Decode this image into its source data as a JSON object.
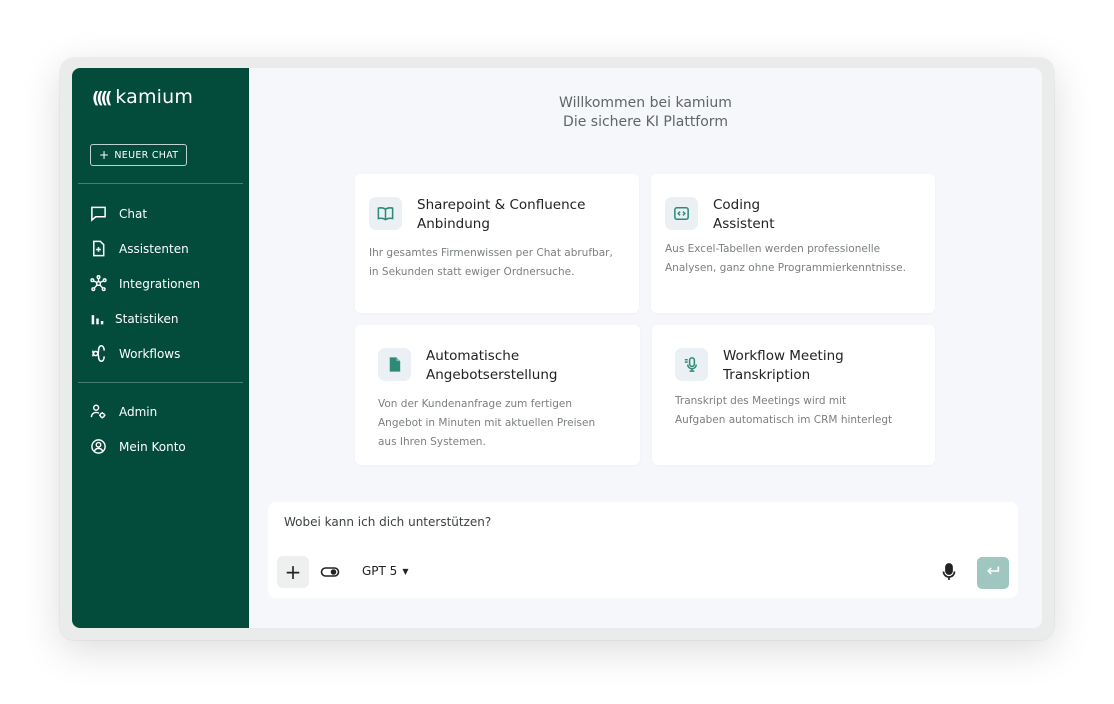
{
  "sidebar": {
    "logo_text": "kamium",
    "new_chat_label": "NEUER CHAT",
    "nav_main": [
      {
        "label": "Chat",
        "icon": "chat-icon"
      },
      {
        "label": "Assistenten",
        "icon": "assistant-icon"
      },
      {
        "label": "Integrationen",
        "icon": "integrations-icon"
      },
      {
        "label": "Statistiken",
        "icon": "statistics-icon"
      },
      {
        "label": "Workflows",
        "icon": "workflows-icon"
      }
    ],
    "nav_account": [
      {
        "label": "Admin",
        "icon": "admin-icon"
      },
      {
        "label": "Mein Konto",
        "icon": "account-icon"
      }
    ]
  },
  "header": {
    "line1": "Willkommen bei kamium",
    "line2": "Die sichere KI Plattform"
  },
  "cards": [
    {
      "title_1": "Sharepoint & Confluence",
      "title_2": "Anbindung",
      "desc_1": "Ihr gesamtes Firmenwissen per Chat abrufbar,",
      "desc_2": "in Sekunden statt ewiger Ordnersuche.",
      "desc_3": "",
      "icon": "book-icon"
    },
    {
      "title_1": "Coding",
      "title_2": "Assistent",
      "desc_1": "Aus Excel-Tabellen werden professionelle",
      "desc_2": "Analysen, ganz ohne Programmierkenntnisse.",
      "desc_3": "",
      "icon": "code-icon"
    },
    {
      "title_1": "Automatische",
      "title_2": "Angebotserstellung",
      "desc_1": "Von der Kundenanfrage zum fertigen",
      "desc_2": "Angebot in Minuten mit aktuellen Preisen",
      "desc_3": "aus Ihren Systemen.",
      "icon": "document-icon"
    },
    {
      "title_1": "Workflow Meeting",
      "title_2": "Transkription",
      "desc_1": "Transkript des Meetings wird mit",
      "desc_2": "Aufgaben automatisch im CRM hinterlegt",
      "desc_3": "",
      "icon": "microphone-icon"
    }
  ],
  "chat_input": {
    "placeholder": "Wobei kann ich dich unterstützen?",
    "value": "",
    "add_label": "+",
    "model": "GPT 5"
  },
  "colors": {
    "sidebar": "#034c3c",
    "accent_icon": "#2e8a77",
    "send_button": "#9fc7bf",
    "background": "#f5f7fa"
  }
}
